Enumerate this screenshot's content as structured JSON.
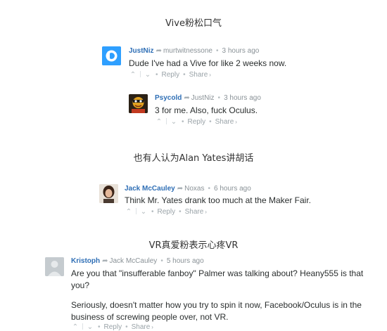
{
  "captions": [
    "Vive粉松口气",
    "也有人认为Alan Yates讲胡话",
    "VR真爱粉表示心疼VR"
  ],
  "comments": [
    {
      "author": "JustNiz",
      "reply_to": "murtwitnessone",
      "time": "3 hours ago",
      "text": [
        "Dude I've had a Vive for like 2 weeks now."
      ],
      "avatar_icon": "disqus-d-icon",
      "avatar_color": "#2e9fff"
    },
    {
      "author": "Psycold",
      "reply_to": "JustNiz",
      "time": "3 hours ago",
      "text": [
        "3 for me. Also, fuck Oculus."
      ],
      "avatar_icon": "cartoon-character-icon"
    },
    {
      "author": "Jack McCauley",
      "reply_to": "Noxas",
      "time": "6 hours ago",
      "text": [
        "Think Mr. Yates drank too much at the Maker Fair."
      ],
      "avatar_icon": "portrait-photo-icon"
    },
    {
      "author": "Kristoph",
      "reply_to": "Jack McCauley",
      "time": "5 hours ago",
      "text": [
        "Are you that \"insufferable fanboy\" Palmer was talking about? Heany555 is that",
        "you?",
        "Seriously, doesn't matter how you try to spin it now, Facebook/Oculus is in the",
        "business of screwing people over, not VR."
      ],
      "avatar_icon": "default-avatar-icon"
    }
  ],
  "actions": {
    "upvote_icon": "chevron-up-icon",
    "downvote_icon": "chevron-down-icon",
    "reply_label": "Reply",
    "share_label": "Share",
    "share_chevron": "›"
  },
  "colors": {
    "author_link": "#2e6eb5",
    "meta_text": "#8a9297",
    "body_text": "#2a2e2e"
  }
}
